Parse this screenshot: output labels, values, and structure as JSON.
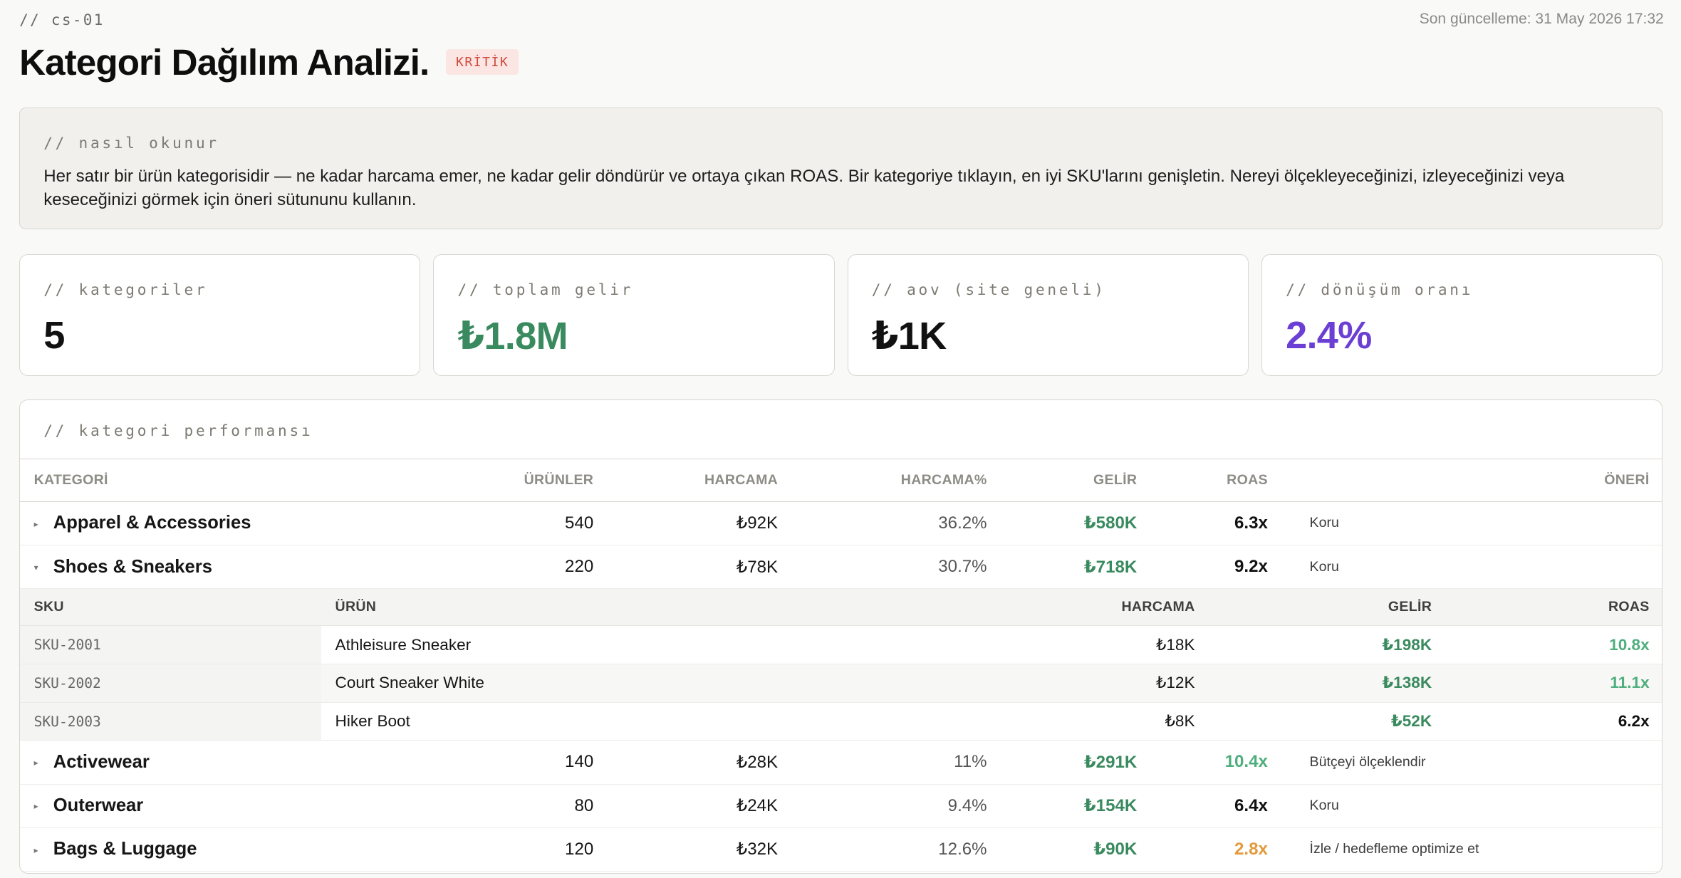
{
  "header": {
    "crumb": "// cs-01",
    "updated": "Son güncelleme: 31 May 2026 17:32",
    "title": "Kategori Dağılım Analizi.",
    "badge": "KRİTİK"
  },
  "explainer": {
    "label": "// nasıl okunur",
    "text": "Her satır bir ürün kategorisidir — ne kadar harcama emer, ne kadar gelir döndürür ve ortaya çıkan ROAS. Bir kategoriye tıklayın, en iyi SKU'larını genişletin. Nereyi ölçekleyeceğinizi, izleyeceğinizi veya keseceğinizi görmek için öneri sütununu kullanın."
  },
  "stats": [
    {
      "label": "// kategoriler",
      "value": "5",
      "color": "#111111"
    },
    {
      "label": "// toplam gelir",
      "value": "₺1.8M",
      "color": "#3a8a5f"
    },
    {
      "label": "// aov (site geneli)",
      "value": "₺1K",
      "color": "#111111"
    },
    {
      "label": "// dönüşüm oranı",
      "value": "2.4%",
      "color": "#6b3fd4"
    }
  ],
  "performance": {
    "label": "// kategori performansı",
    "columns": {
      "category": "KATEGORİ",
      "products": "ÜRÜNLER",
      "spend": "HARCAMA",
      "spend_pct": "HARCAMA%",
      "revenue": "GELİR",
      "roas": "ROAS",
      "recommendation": "ÖNERİ"
    },
    "rows": [
      {
        "name": "Apparel & Accessories",
        "expanded": false,
        "products": "540",
        "spend": "₺92K",
        "spend_pct": "36.2%",
        "revenue": "₺580K",
        "roas": "6.3x",
        "roas_color": "#111111",
        "recommendation": "Koru"
      },
      {
        "name": "Shoes & Sneakers",
        "expanded": true,
        "products": "220",
        "spend": "₺78K",
        "spend_pct": "30.7%",
        "revenue": "₺718K",
        "roas": "9.2x",
        "roas_color": "#111111",
        "recommendation": "Koru"
      },
      {
        "name": "Activewear",
        "expanded": false,
        "products": "140",
        "spend": "₺28K",
        "spend_pct": "11%",
        "revenue": "₺291K",
        "roas": "10.4x",
        "roas_color": "#4fae7d",
        "recommendation": "Bütçeyi ölçeklendir"
      },
      {
        "name": "Outerwear",
        "expanded": false,
        "products": "80",
        "spend": "₺24K",
        "spend_pct": "9.4%",
        "revenue": "₺154K",
        "roas": "6.4x",
        "roas_color": "#111111",
        "recommendation": "Koru"
      },
      {
        "name": "Bags & Luggage",
        "expanded": false,
        "products": "120",
        "spend": "₺32K",
        "spend_pct": "12.6%",
        "revenue": "₺90K",
        "roas": "2.8x",
        "roas_color": "#e29a3b",
        "recommendation": "İzle / hedefleme optimize et"
      }
    ],
    "sku_columns": {
      "sku": "SKU",
      "product": "ÜRÜN",
      "spend": "HARCAMA",
      "revenue": "GELİR",
      "roas": "ROAS"
    },
    "skus": [
      {
        "sku": "SKU-2001",
        "product": "Athleisure Sneaker",
        "spend": "₺18K",
        "revenue": "₺198K",
        "roas": "10.8x",
        "roas_color": "#4fae7d"
      },
      {
        "sku": "SKU-2002",
        "product": "Court Sneaker White",
        "spend": "₺12K",
        "revenue": "₺138K",
        "roas": "11.1x",
        "roas_color": "#4fae7d"
      },
      {
        "sku": "SKU-2003",
        "product": "Hiker Boot",
        "spend": "₺8K",
        "revenue": "₺52K",
        "roas": "6.2x",
        "roas_color": "#111111"
      }
    ],
    "revenue_color": "#3a8a5f",
    "caret_collapsed": "▸",
    "caret_expanded": "▾"
  }
}
